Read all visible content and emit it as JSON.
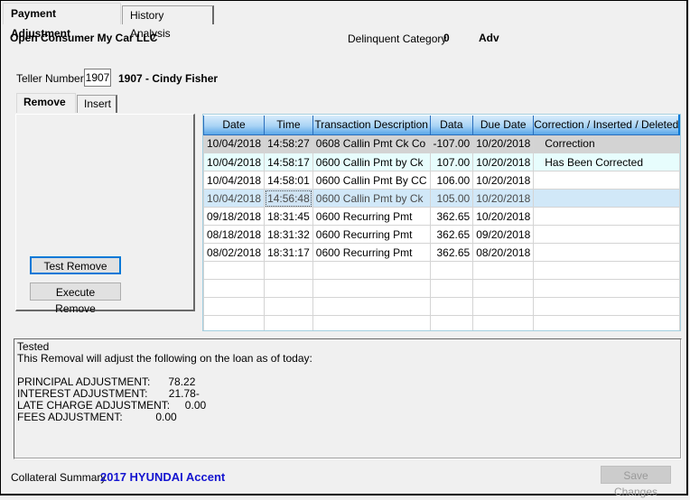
{
  "tabs": [
    {
      "label": "Payment Adjustment",
      "active": true
    },
    {
      "label": "History Analysis",
      "active": false
    }
  ],
  "header": {
    "account_name": "Open Consumer My Car LLC",
    "delinquent_label": "Delinquent Category",
    "delinquent_value": "0",
    "delinquent_flag": "Adv"
  },
  "teller": {
    "label": "Teller Number",
    "number": "1907",
    "name": "1907 - Cindy Fisher"
  },
  "inner_tabs": [
    {
      "label": "Remove",
      "active": true
    },
    {
      "label": "Insert",
      "active": false
    }
  ],
  "buttons": {
    "test_remove": "Test Remove",
    "execute_remove": "Execute Remove",
    "save_changes": "Save Changes"
  },
  "grid": {
    "columns": [
      "Date",
      "Time",
      "Transaction Description",
      "Data",
      "Due Date",
      "Correction / Inserted / Deleted"
    ],
    "rows": [
      {
        "date": "10/04/2018",
        "time": "14:58:27",
        "desc": "0608 Callin Pmt Ck Co",
        "data": "-107.00",
        "due": "10/20/2018",
        "status": "Correction",
        "style": "gray"
      },
      {
        "date": "10/04/2018",
        "time": "14:58:17",
        "desc": "0600 Callin Pmt by Ck",
        "data": "107.00",
        "due": "10/20/2018",
        "status": "Has Been Corrected",
        "style": "cyan"
      },
      {
        "date": "10/04/2018",
        "time": "14:58:01",
        "desc": "0600 Callin Pmt By CC",
        "data": "106.00",
        "due": "10/20/2018",
        "status": "",
        "style": "white"
      },
      {
        "date": "10/04/2018",
        "time": "14:56:48",
        "desc": "0600 Callin Pmt by Ck",
        "data": "105.00",
        "due": "10/20/2018",
        "status": "",
        "style": "sel"
      },
      {
        "date": "09/18/2018",
        "time": "18:31:45",
        "desc": "0600 Recurring Pmt",
        "data": "362.65",
        "due": "10/20/2018",
        "status": "",
        "style": "white"
      },
      {
        "date": "08/18/2018",
        "time": "18:31:32",
        "desc": "0600 Recurring Pmt",
        "data": "362.65",
        "due": "09/20/2018",
        "status": "",
        "style": "white"
      },
      {
        "date": "08/02/2018",
        "time": "18:31:17",
        "desc": "0600 Recurring Pmt",
        "data": "362.65",
        "due": "08/20/2018",
        "status": "",
        "style": "white"
      }
    ],
    "empty_rows": 5
  },
  "message": {
    "lines": [
      "Tested",
      "This Removal will adjust the following on the loan as of today:",
      "",
      "PRINCIPAL ADJUSTMENT:      78.22",
      "INTEREST ADJUSTMENT:       21.78-",
      "LATE CHARGE ADJUSTMENT:     0.00",
      "FEES ADJUSTMENT:           0.00"
    ]
  },
  "footer": {
    "collateral_label": "Collateral Summary",
    "collateral_value": "2017 HYUNDAI Accent"
  }
}
